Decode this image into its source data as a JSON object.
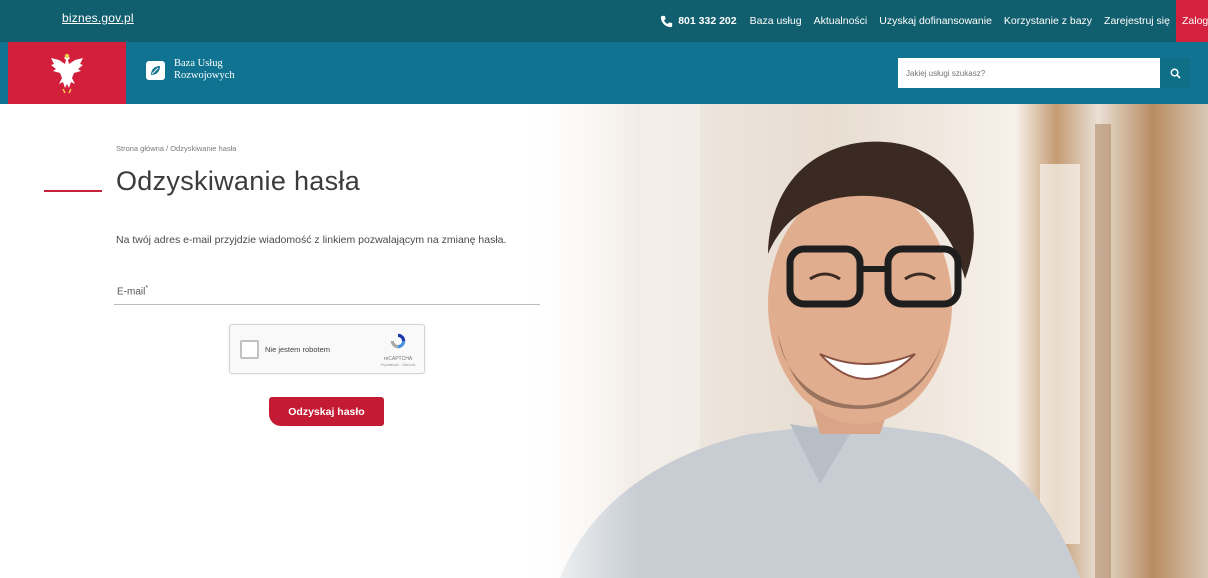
{
  "topbar": {
    "site_link": "biznes.gov.pl",
    "phone": "801 332 202",
    "links": [
      "Baza usług",
      "Aktualności",
      "Uzyskaj dofinansowanie",
      "Korzystanie z bazy",
      "Zarejestruj się"
    ],
    "login": "Zaloguj się"
  },
  "header": {
    "logo_line1": "Baza Usług",
    "logo_line2": "Rozwojowych",
    "search_placeholder": "Jakiej usługi szukasz?"
  },
  "breadcrumb": "Strona główna / Odzyskiwanie hasła",
  "page_title": "Odzyskiwanie hasła",
  "info_text": "Na twój adres e-mail przyjdzie wiadomość z linkiem pozwalającym na zmianę hasła.",
  "form": {
    "email_label": "E-mail",
    "required_mark": "*",
    "captcha_label": "Nie jestem robotem",
    "captcha_brand": "reCAPTCHA",
    "captcha_links": "Prywatność - Warunki",
    "submit_label": "Odzyskaj hasło"
  },
  "colors": {
    "topbar": "#115f6e",
    "header": "#0f7391",
    "accent_red": "#c41a34"
  },
  "icons": [
    "phone-icon",
    "eagle-emblem-icon",
    "leaf-logo-icon",
    "search-icon",
    "recaptcha-icon"
  ]
}
